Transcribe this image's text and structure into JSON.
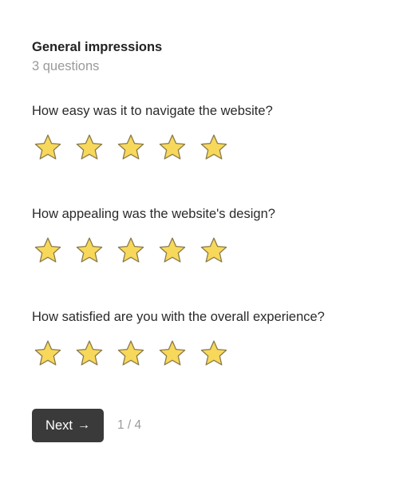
{
  "section": {
    "title": "General impressions",
    "subtitle": "3 questions"
  },
  "questions": [
    {
      "text": "How easy was it to navigate the website?",
      "max_rating": 5
    },
    {
      "text": "How appealing was the website's design?",
      "max_rating": 5
    },
    {
      "text": "How satisfied are you with the overall experience?",
      "max_rating": 5
    }
  ],
  "icons": {
    "star": "star-icon",
    "arrow": "arrow-right-icon"
  },
  "colors": {
    "star_fill": "#f7d85a",
    "star_stroke": "#8a7a4a",
    "button_bg": "#3a3a3a",
    "button_text": "#ffffff",
    "muted_text": "#9a9a9a"
  },
  "footer": {
    "next_label": "Next",
    "arrow_glyph": "→",
    "page_indicator": "1 / 4"
  }
}
